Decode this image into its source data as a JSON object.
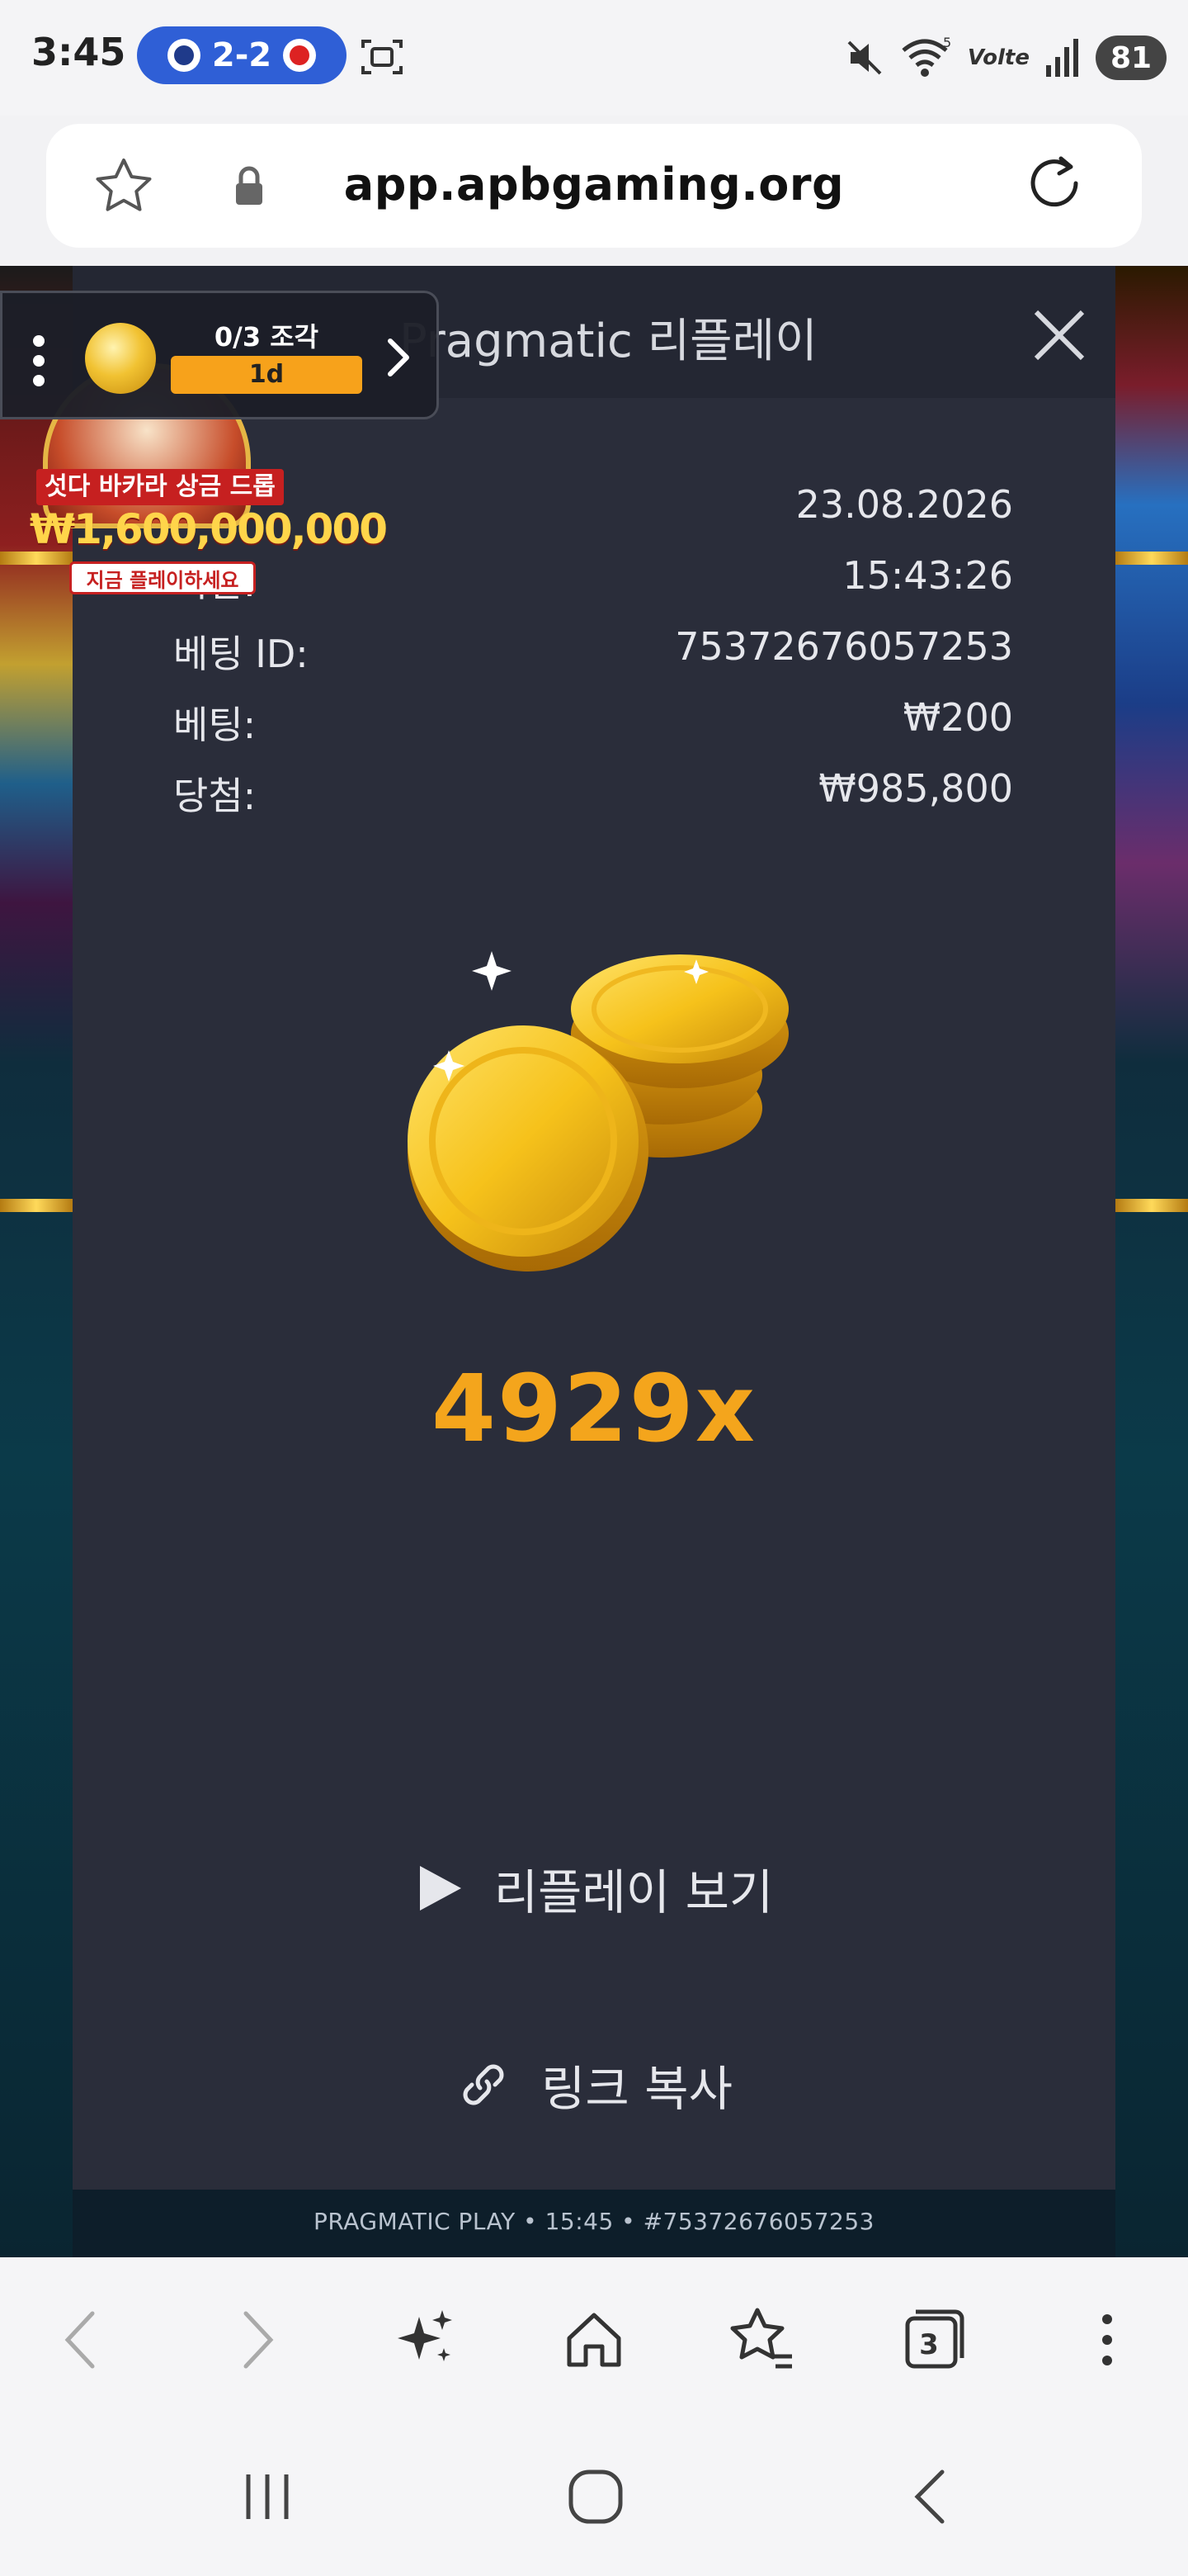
{
  "status_bar": {
    "time": "3:45",
    "score": "2-2",
    "network_label": "Volte",
    "wifi_badge": "5",
    "battery": "81"
  },
  "browser": {
    "url": "app.apbgaming.org",
    "tabs_count": "3"
  },
  "widget": {
    "fragments": "0/3 조각",
    "time_left": "1d"
  },
  "promo": {
    "title": "섯다 바카라 상금 드롭",
    "amount": "₩1,600,000,000",
    "cta": "지금 플레이하세요"
  },
  "modal": {
    "title": "Pragmatic 리플레이",
    "rows": [
      {
        "label": "",
        "value": "23.08.2026"
      },
      {
        "label": "시간:",
        "value": "15:43:26"
      },
      {
        "label": "베팅 ID:",
        "value": "75372676057253"
      },
      {
        "label": "베팅:",
        "value": "₩200"
      },
      {
        "label": "당첨:",
        "value": "₩985,800"
      }
    ],
    "multiplier": "4929x",
    "replay_label": "리플레이 보기",
    "copy_link_label": "링크 복사"
  },
  "game": {
    "footer": "PRAGMATIC PLAY • 15:45 • #75372676057253"
  },
  "colors": {
    "modal_bg": "#2a2d3a",
    "multiplier": "#f4a51c",
    "score_pill": "#2f5fd6",
    "widget_timer": "#f7a21b"
  }
}
